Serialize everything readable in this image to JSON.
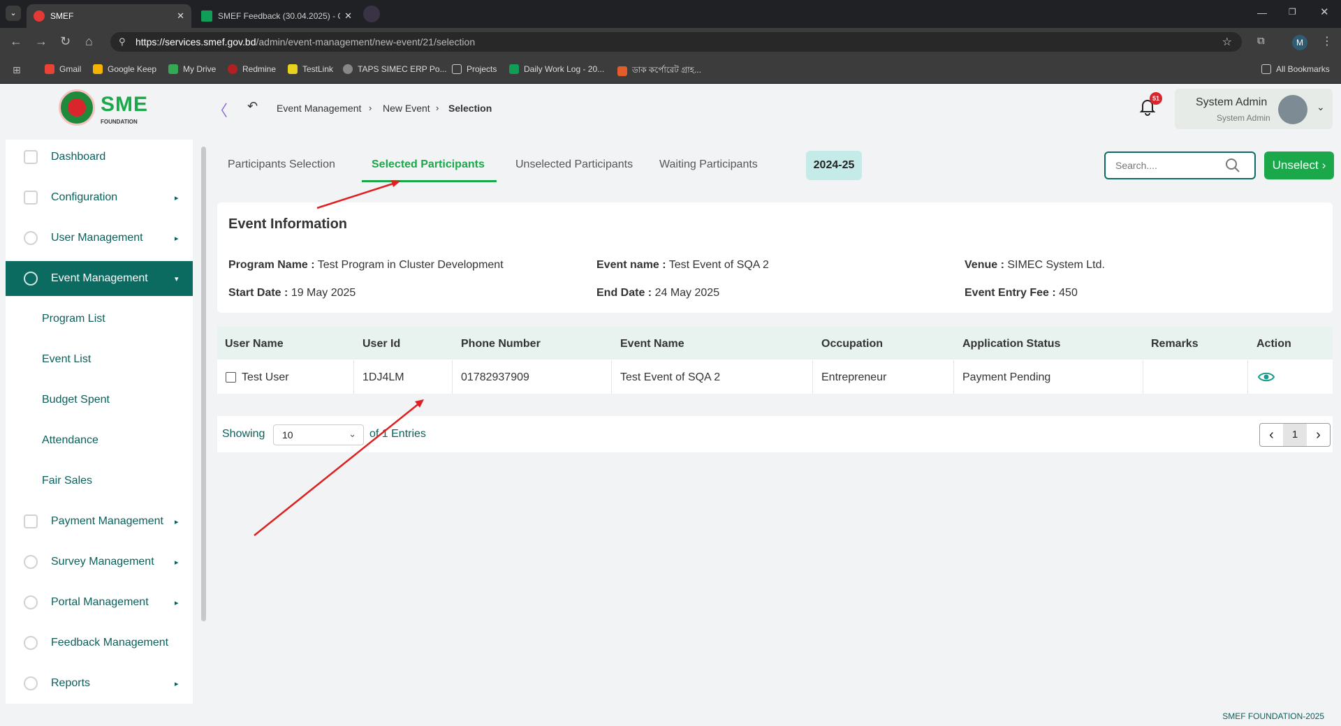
{
  "browser": {
    "tabs": [
      {
        "title": "SMEF"
      },
      {
        "title": "SMEF Feedback (30.04.2025) - G"
      }
    ],
    "url_host": "https://services.smef.gov.bd",
    "url_path": "/admin/event-management/new-event/21/selection",
    "profile_initial": "M",
    "bookmarks": [
      "Gmail",
      "Google Keep",
      "My Drive",
      "Redmine",
      "TestLink",
      "TAPS SIMEC ERP Po...",
      "Projects",
      "Daily Work Log - 20...",
      "ডাক কর্পোরেট গ্রাহ..."
    ],
    "all_bookmarks": "All Bookmarks"
  },
  "header": {
    "logo_text": "SME",
    "logo_sub": "FOUNDATION",
    "breadcrumb": [
      "Event Management",
      "New Event",
      "Selection"
    ],
    "notification_count": "51",
    "user_name": "System Admin",
    "user_role": "System Admin"
  },
  "sidebar": {
    "items": [
      {
        "label": "Dashboard"
      },
      {
        "label": "Configuration"
      },
      {
        "label": "User Management"
      },
      {
        "label": "Event Management"
      },
      {
        "label": "Payment Management"
      },
      {
        "label": "Survey Management"
      },
      {
        "label": "Portal Management"
      },
      {
        "label": "Feedback Management"
      },
      {
        "label": "Reports"
      }
    ],
    "sub_items": [
      "Program List",
      "Event List",
      "Budget Spent",
      "Attendance",
      "Fair Sales"
    ]
  },
  "tabs": [
    "Participants Selection",
    "Selected Participants",
    "Unselected Participants",
    "Waiting Participants"
  ],
  "active_tab": "Selected Participants",
  "fiscal_year": "2024-25",
  "search_placeholder": "Search....",
  "unselect_label": "Unselect",
  "event_info": {
    "title": "Event Information",
    "program_name_label": "Program Name :",
    "program_name": "Test Program in Cluster Development",
    "event_name_label": "Event name :",
    "event_name": "Test Event of SQA 2",
    "venue_label": "Venue :",
    "venue": "SIMEC System Ltd.",
    "start_date_label": "Start Date :",
    "start_date": "19 May 2025",
    "end_date_label": "End Date :",
    "end_date": "24 May 2025",
    "fee_label": "Event Entry Fee :",
    "fee": "450"
  },
  "table": {
    "headers": [
      "User Name",
      "User Id",
      "Phone Number",
      "Event Name",
      "Occupation",
      "Application Status",
      "Remarks",
      "Action"
    ],
    "rows": [
      [
        "Test User",
        "1DJ4LM",
        "01782937909",
        "Test Event of SQA 2",
        "Entrepreneur",
        "Payment Pending",
        ""
      ]
    ]
  },
  "pagination": {
    "showing_label": "Showing",
    "page_size": "10",
    "entries_text": "of 1 Entries",
    "current_page": "1"
  },
  "footer": "SMEF FOUNDATION-2025",
  "colors": {
    "brand": "#0c6b61",
    "accent_green": "#1aa84a",
    "active_tab": "#1aa84a",
    "badge_red": "#d9262c"
  }
}
